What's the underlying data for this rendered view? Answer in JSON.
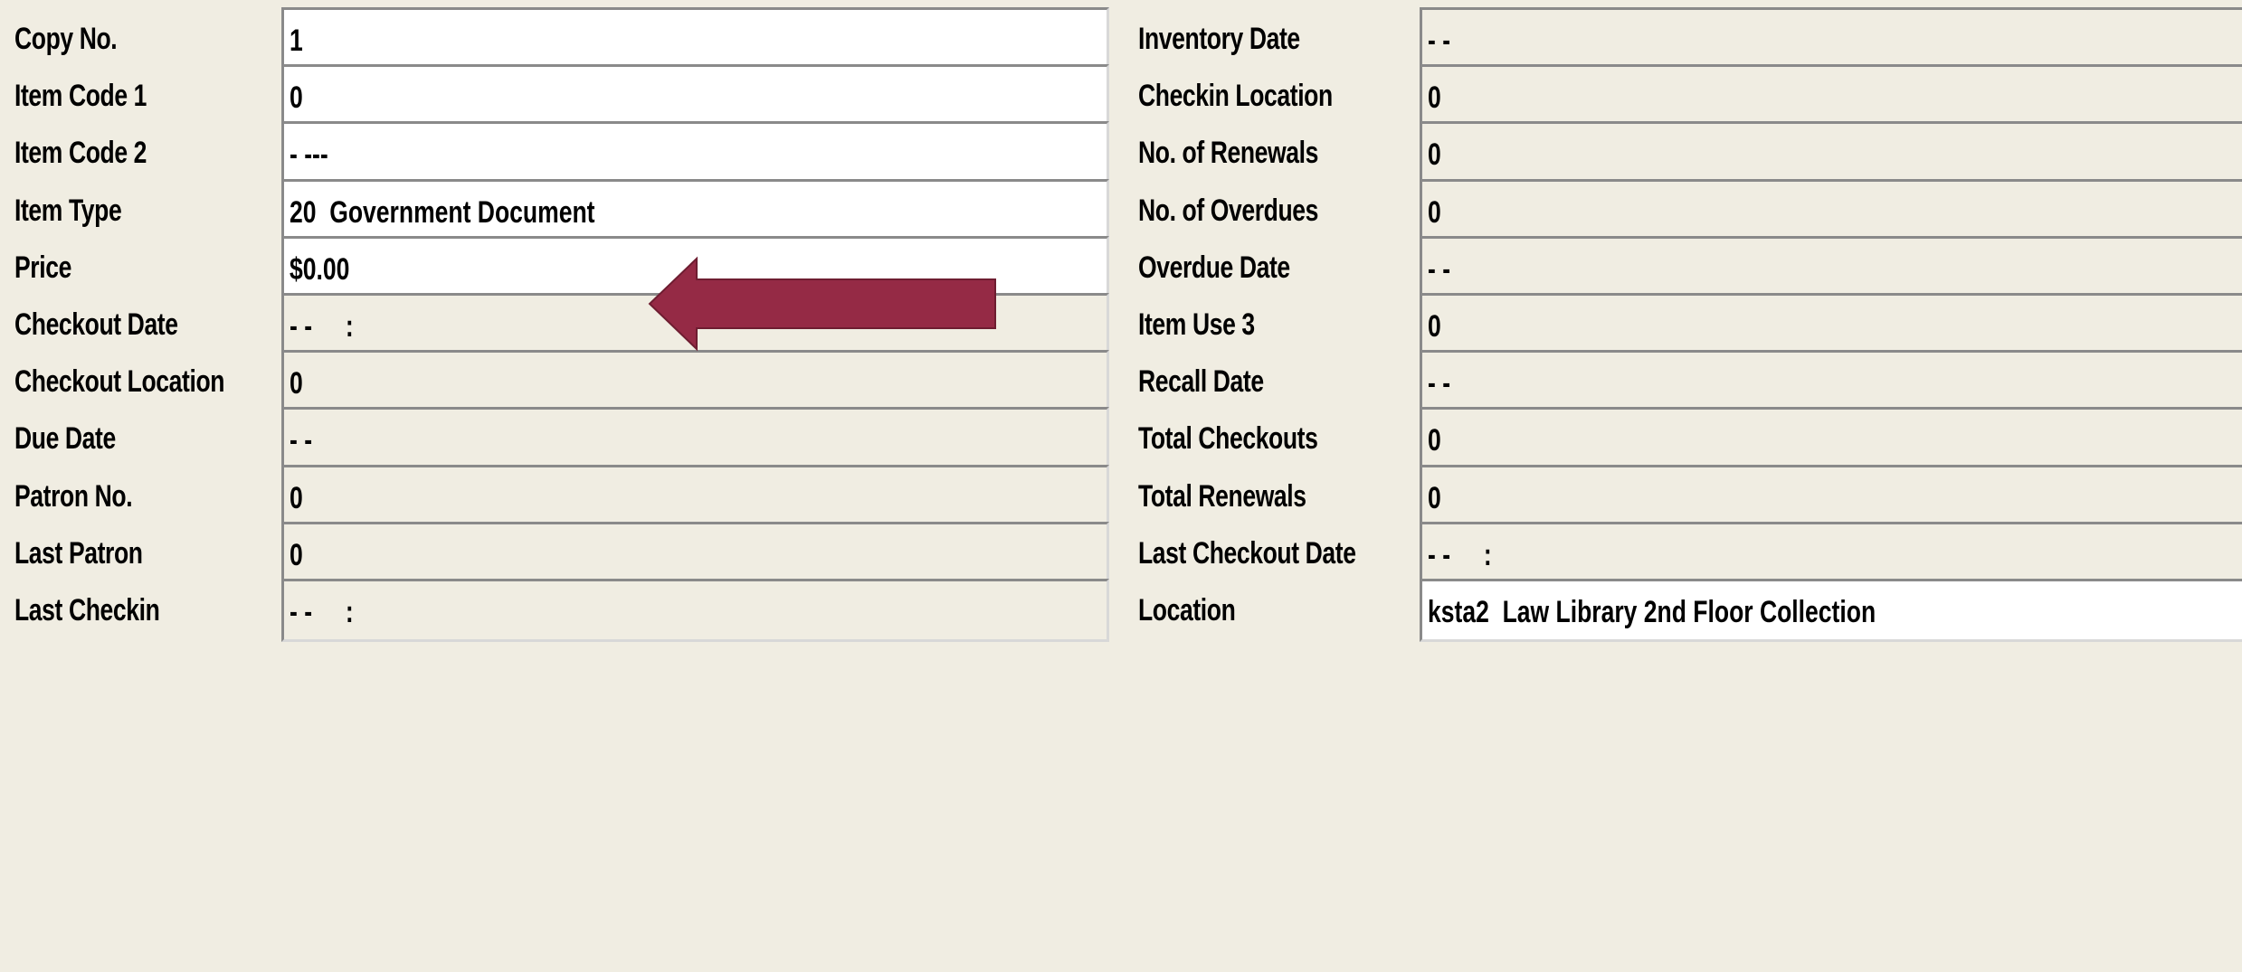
{
  "left_fields": [
    {
      "label": "Copy No.",
      "value": "1",
      "editable": true
    },
    {
      "label": "Item Code 1",
      "value": "0",
      "editable": true
    },
    {
      "label": "Item Code 2",
      "value": "- ---",
      "editable": true
    },
    {
      "label": "Item Type",
      "value": "20  Government Document",
      "editable": true
    },
    {
      "label": "Price",
      "value": "$0.00",
      "editable": true
    },
    {
      "label": "Checkout Date",
      "value": "- -     :",
      "editable": false
    },
    {
      "label": "Checkout Location",
      "value": "0",
      "editable": false
    },
    {
      "label": "Due Date",
      "value": "- -",
      "editable": false
    },
    {
      "label": "Patron No.",
      "value": "0",
      "editable": false
    },
    {
      "label": "Last Patron",
      "value": "0",
      "editable": false
    },
    {
      "label": "Last Checkin",
      "value": "- -     :",
      "editable": false
    }
  ],
  "right_fields": [
    {
      "label": "Inventory Date",
      "value": "- -",
      "editable": false
    },
    {
      "label": "Checkin Location",
      "value": "0",
      "editable": false
    },
    {
      "label": "No. of Renewals",
      "value": "0",
      "editable": false
    },
    {
      "label": "No. of Overdues",
      "value": "0",
      "editable": false
    },
    {
      "label": "Overdue Date",
      "value": "- -",
      "editable": false
    },
    {
      "label": "Item Use 3",
      "value": "0",
      "editable": false
    },
    {
      "label": "Recall Date",
      "value": "- -",
      "editable": false
    },
    {
      "label": "Total Checkouts",
      "value": "0",
      "editable": false
    },
    {
      "label": "Total Renewals",
      "value": "0",
      "editable": false
    },
    {
      "label": "Last Checkout Date",
      "value": "- -     :",
      "editable": false
    },
    {
      "label": "Location",
      "value": "ksta2  Law Library 2nd Floor Collection",
      "editable": true
    }
  ],
  "colors": {
    "background": "#f0ede2",
    "annotation_arrow": "#952a45"
  }
}
